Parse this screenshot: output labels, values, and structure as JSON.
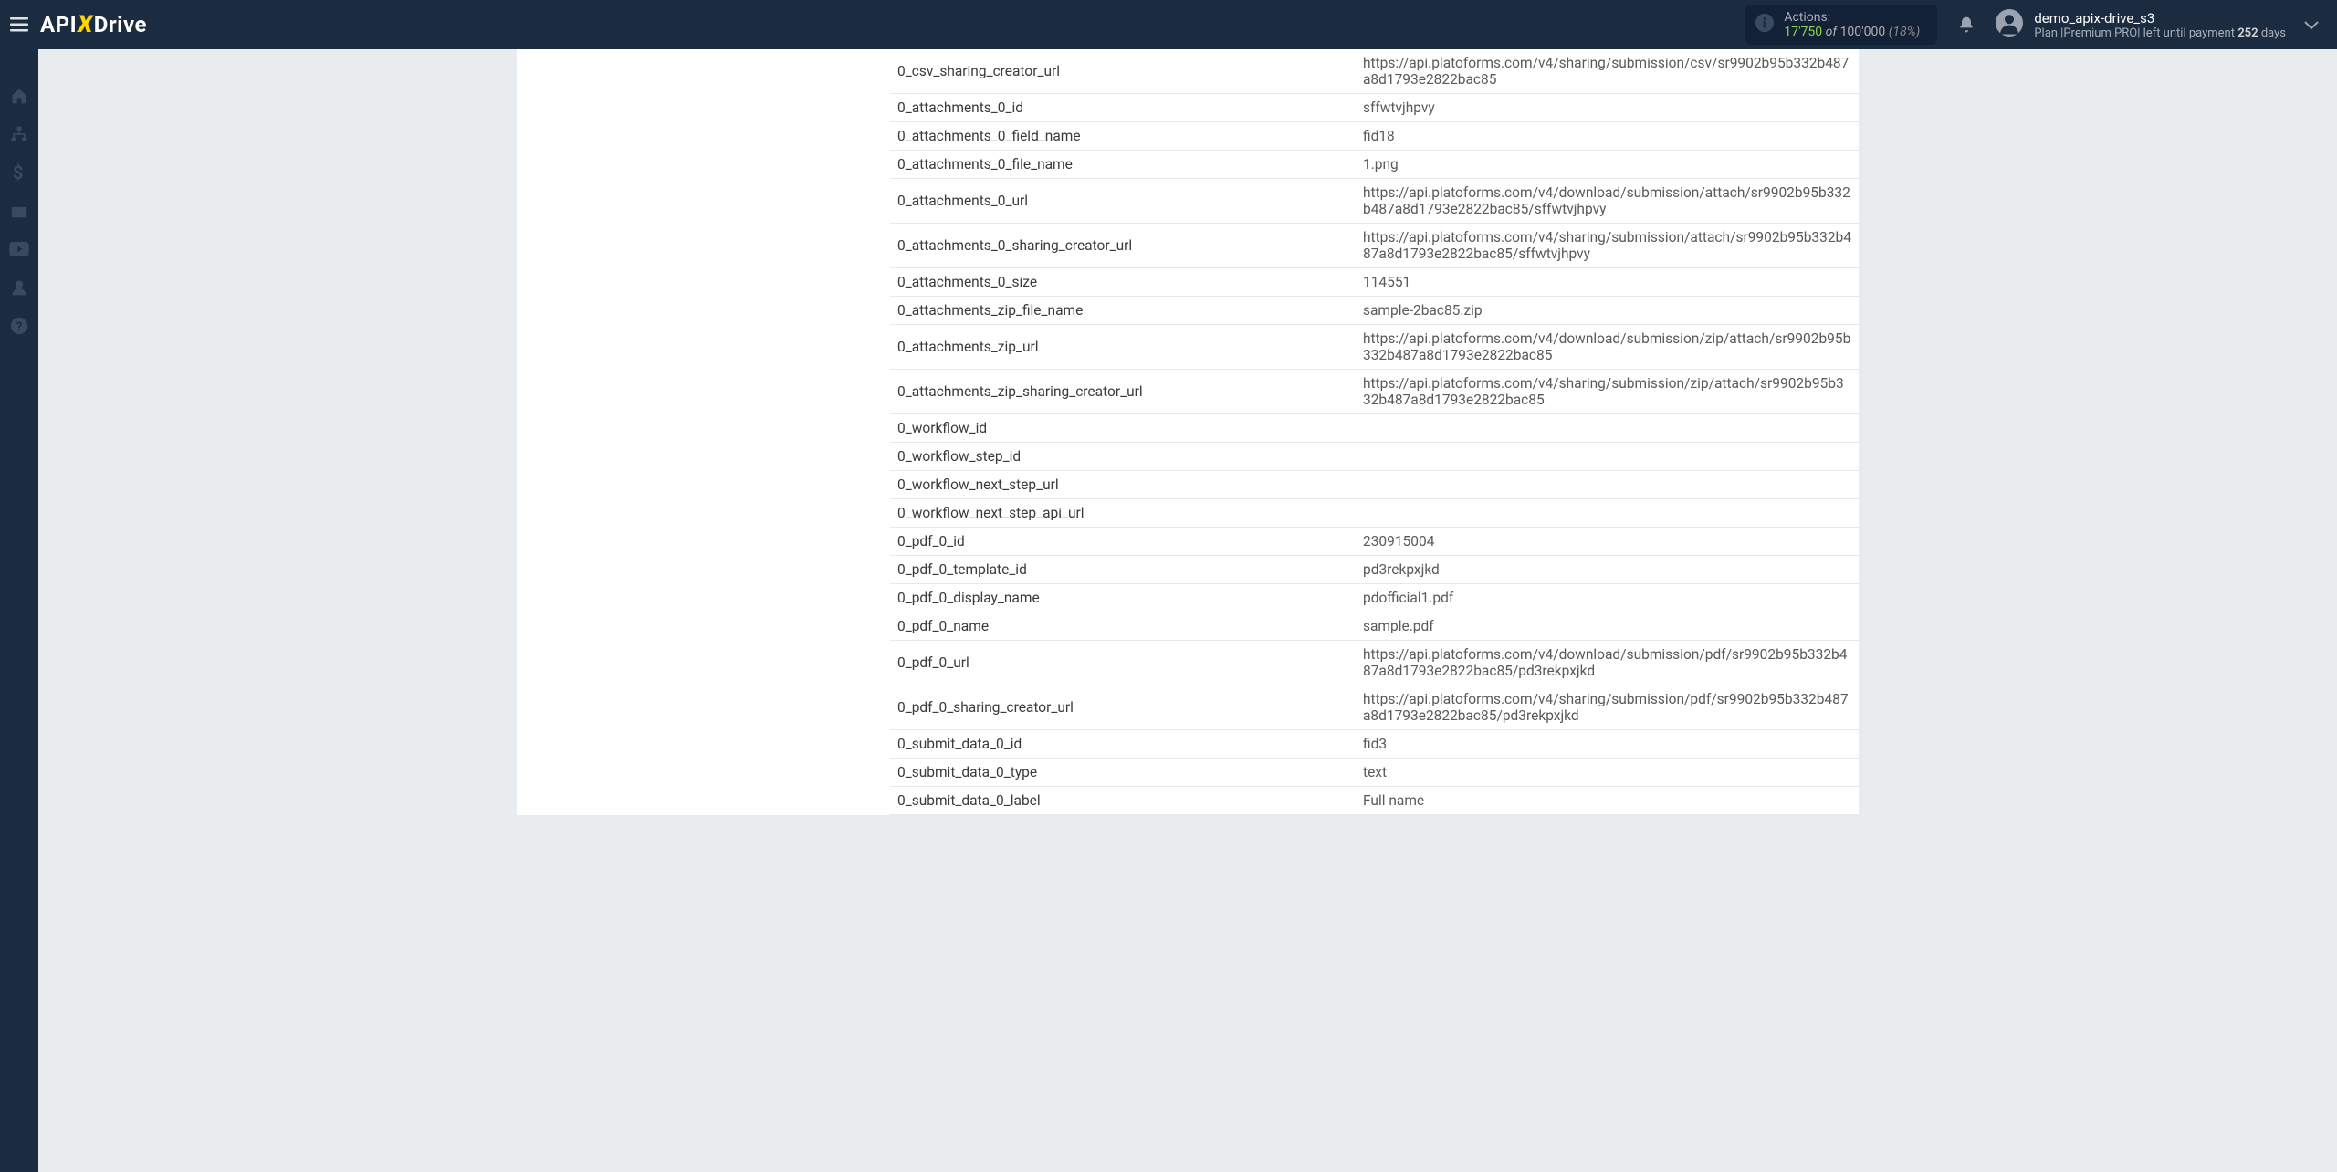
{
  "header": {
    "logo": {
      "api": "API",
      "x": "X",
      "drive": "Drive"
    },
    "actions": {
      "label": "Actions:",
      "used": "17'750",
      "of": "of",
      "total": "100'000",
      "pct": "(18%)"
    },
    "user": {
      "name": "demo_apix-drive_s3",
      "plan_prefix": "Plan |Premium PRO| left until payment ",
      "plan_days_num": "252",
      "plan_days_suffix": " days"
    }
  },
  "rows": [
    {
      "key": "0_csv_sharing_creator_url",
      "val": "https://api.platoforms.com/v4/sharing/submission/csv/sr9902b95b332b487a8d1793e2822bac85"
    },
    {
      "key": "0_attachments_0_id",
      "val": "sffwtvjhpvy"
    },
    {
      "key": "0_attachments_0_field_name",
      "val": "fid18"
    },
    {
      "key": "0_attachments_0_file_name",
      "val": "1.png"
    },
    {
      "key": "0_attachments_0_url",
      "val": "https://api.platoforms.com/v4/download/submission/attach/sr9902b95b332b487a8d1793e2822bac85/sffwtvjhpvy"
    },
    {
      "key": "0_attachments_0_sharing_creator_url",
      "val": "https://api.platoforms.com/v4/sharing/submission/attach/sr9902b95b332b487a8d1793e2822bac85/sffwtvjhpvy"
    },
    {
      "key": "0_attachments_0_size",
      "val": "114551"
    },
    {
      "key": "0_attachments_zip_file_name",
      "val": "sample-2bac85.zip"
    },
    {
      "key": "0_attachments_zip_url",
      "val": "https://api.platoforms.com/v4/download/submission/zip/attach/sr9902b95b332b487a8d1793e2822bac85"
    },
    {
      "key": "0_attachments_zip_sharing_creator_url",
      "val": "https://api.platoforms.com/v4/sharing/submission/zip/attach/sr9902b95b332b487a8d1793e2822bac85"
    },
    {
      "key": "0_workflow_id",
      "val": ""
    },
    {
      "key": "0_workflow_step_id",
      "val": ""
    },
    {
      "key": "0_workflow_next_step_url",
      "val": ""
    },
    {
      "key": "0_workflow_next_step_api_url",
      "val": ""
    },
    {
      "key": "0_pdf_0_id",
      "val": "230915004"
    },
    {
      "key": "0_pdf_0_template_id",
      "val": "pd3rekpxjkd"
    },
    {
      "key": "0_pdf_0_display_name",
      "val": "pdofficial1.pdf"
    },
    {
      "key": "0_pdf_0_name",
      "val": "sample.pdf"
    },
    {
      "key": "0_pdf_0_url",
      "val": "https://api.platoforms.com/v4/download/submission/pdf/sr9902b95b332b487a8d1793e2822bac85/pd3rekpxjkd"
    },
    {
      "key": "0_pdf_0_sharing_creator_url",
      "val": "https://api.platoforms.com/v4/sharing/submission/pdf/sr9902b95b332b487a8d1793e2822bac85/pd3rekpxjkd"
    },
    {
      "key": "0_submit_data_0_id",
      "val": "fid3"
    },
    {
      "key": "0_submit_data_0_type",
      "val": "text"
    },
    {
      "key": "0_submit_data_0_label",
      "val": "Full name"
    }
  ]
}
